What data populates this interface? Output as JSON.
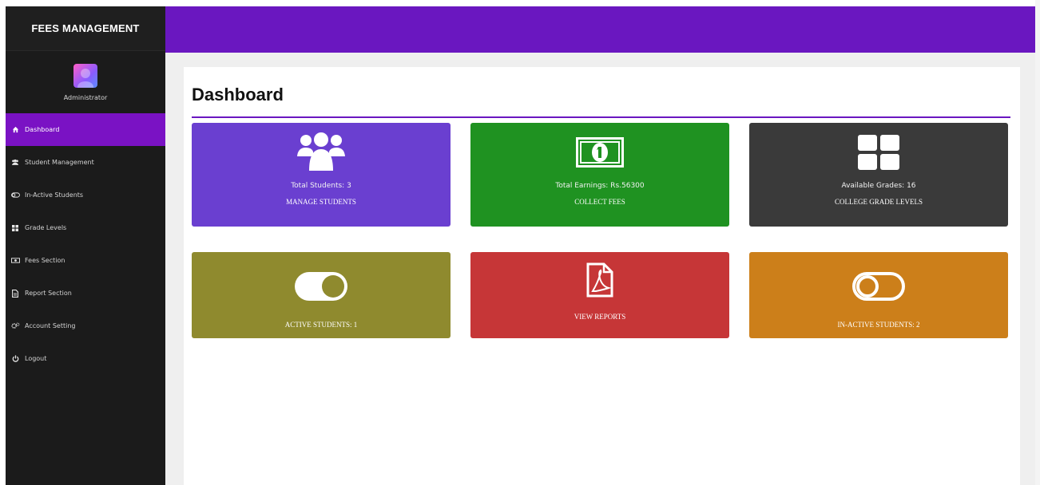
{
  "sidebar": {
    "brand": "FEES MANAGEMENT",
    "profile_name": "Administrator",
    "items": [
      {
        "label": "Dashboard",
        "icon": "dashboard-icon",
        "active": true
      },
      {
        "label": "Student Management",
        "icon": "users-icon",
        "active": false
      },
      {
        "label": "In-Active Students",
        "icon": "toggle-off-icon",
        "active": false
      },
      {
        "label": "Grade Levels",
        "icon": "grid-icon",
        "active": false
      },
      {
        "label": "Fees Section",
        "icon": "money-icon",
        "active": false
      },
      {
        "label": "Report Section",
        "icon": "file-icon",
        "active": false
      },
      {
        "label": "Account Setting",
        "icon": "gears-icon",
        "active": false
      },
      {
        "label": "Logout",
        "icon": "power-icon",
        "active": false
      }
    ]
  },
  "main": {
    "title": "Dashboard",
    "tiles": [
      {
        "line1": "Total Students: 3",
        "line2": "MANAGE STUDENTS",
        "color": "#6a3fd0",
        "icon": "users-icon"
      },
      {
        "line1": "Total Earnings: Rs.56300",
        "line2": "COLLECT FEES",
        "color": "#1f9221",
        "icon": "money-icon"
      },
      {
        "line1": "Available Grades: 16",
        "line2": "COLLEGE GRADE LEVELS",
        "color": "#3a3a3a",
        "icon": "grid-icon"
      },
      {
        "line1": "",
        "line2": "ACTIVE STUDENTS: 1",
        "color": "#8f8a2e",
        "icon": "toggle-on-icon"
      },
      {
        "line1": "",
        "line2": "VIEW REPORTS",
        "color": "#c63637",
        "icon": "pdf-icon"
      },
      {
        "line1": "",
        "line2": "IN-ACTIVE STUDENTS: 2",
        "color": "#cc7f1a",
        "icon": "toggle-off-icon"
      }
    ]
  },
  "colors": {
    "accent": "#6a17c0",
    "sidebar_bg": "#1b1b1b",
    "active_nav": "#7a12c4"
  }
}
